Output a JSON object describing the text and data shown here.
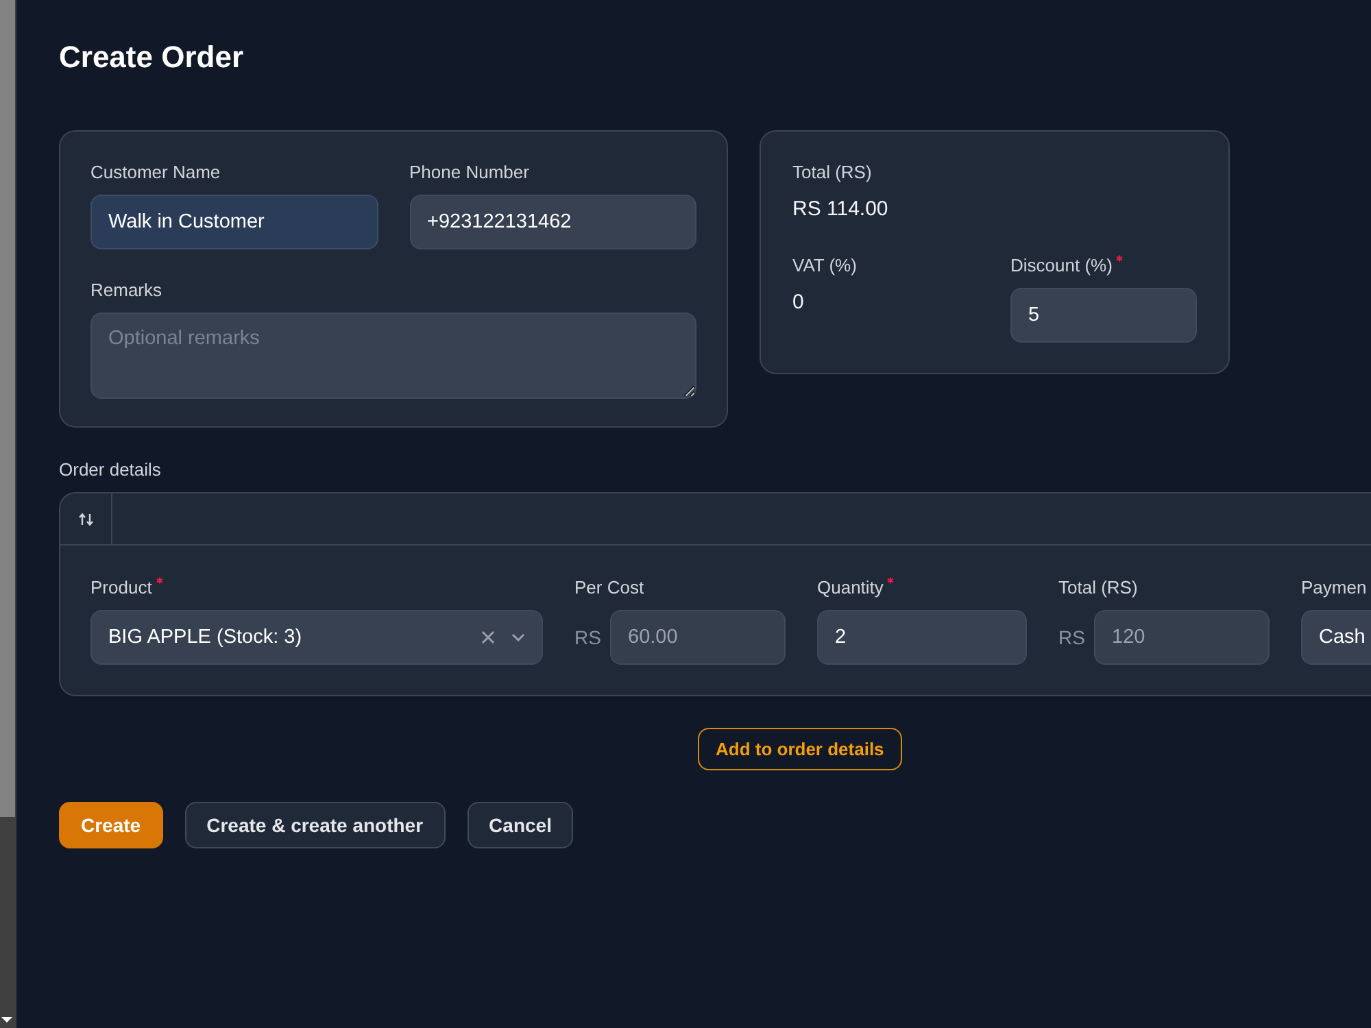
{
  "page": {
    "title": "Create Order"
  },
  "customer_card": {
    "customer_name": {
      "label": "Customer Name",
      "value": "Walk in Customer",
      "autofilled": true
    },
    "phone_number": {
      "label": "Phone Number",
      "value": "+923122131462",
      "autofilled": false
    },
    "remarks": {
      "label": "Remarks",
      "placeholder": "Optional remarks"
    }
  },
  "summary_card": {
    "total": {
      "label": "Total (RS)",
      "value": "RS 114.00"
    },
    "vat": {
      "label": "VAT (%)",
      "value": "0"
    },
    "discount": {
      "label": "Discount (%)",
      "value": "5",
      "required": true
    }
  },
  "order_details": {
    "label": "Order details",
    "items": [
      {
        "fields": [
          {
            "kind": "select",
            "label": "Product",
            "required": true,
            "value": "BIG APPLE (Stock: 3)",
            "clearable": true
          },
          {
            "kind": "input",
            "label": "Per Cost",
            "required": false,
            "prefix": "RS",
            "value": "60.00",
            "disabled": true
          },
          {
            "kind": "input",
            "label": "Quantity",
            "required": true,
            "value": "2",
            "disabled": false
          },
          {
            "kind": "input",
            "label": "Total (RS)",
            "required": false,
            "prefix": "RS",
            "value": "120",
            "disabled": true
          },
          {
            "kind": "partial",
            "label": "Paymen",
            "required": false,
            "value": "Cash"
          }
        ]
      }
    ],
    "add_button": "Add to order details"
  },
  "actions": [
    {
      "label": "Create",
      "kind": "primary"
    },
    {
      "label": "Create & create another",
      "kind": "secondary"
    },
    {
      "label": "Cancel",
      "kind": "secondary"
    }
  ]
}
